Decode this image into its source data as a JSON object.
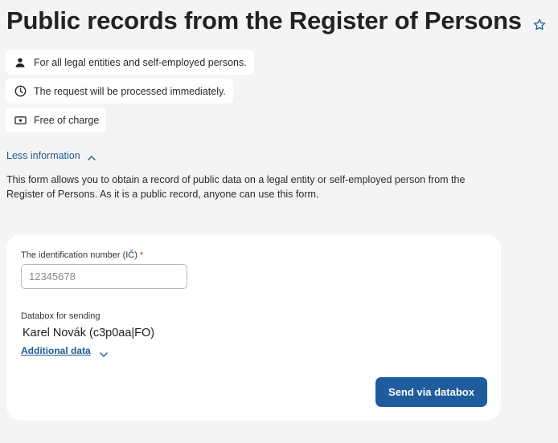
{
  "header": {
    "title": "Public records from the Register of Persons",
    "favorite_icon": "star-outline-icon"
  },
  "chips": [
    {
      "icon": "person-icon",
      "text": "For all legal entities and self-employed persons."
    },
    {
      "icon": "clock-icon",
      "text": "The request will be processed immediately."
    },
    {
      "icon": "money-icon",
      "text": "Free of charge"
    }
  ],
  "info_toggle": {
    "label": "Less information",
    "icon": "chevron-up-icon"
  },
  "description": "This form allows you to obtain a record of public data on a legal entity or self-employed person from the Register of Persons. As it is a public record, anyone can use this form.",
  "form": {
    "ic_label": "The identification number (IČ)",
    "ic_required_mark": "*",
    "ic_placeholder": "12345678",
    "ic_value": "",
    "databox_label": "Databox for sending",
    "databox_value": "Karel Novák (c3p0aa|FO)",
    "additional_data_label": "Additional data",
    "send_button_label": "Send via databox"
  },
  "colors": {
    "background": "#f4f4f4",
    "link": "#1f5a96",
    "primary_button": "#1f5c9e",
    "required": "#c43a16"
  }
}
